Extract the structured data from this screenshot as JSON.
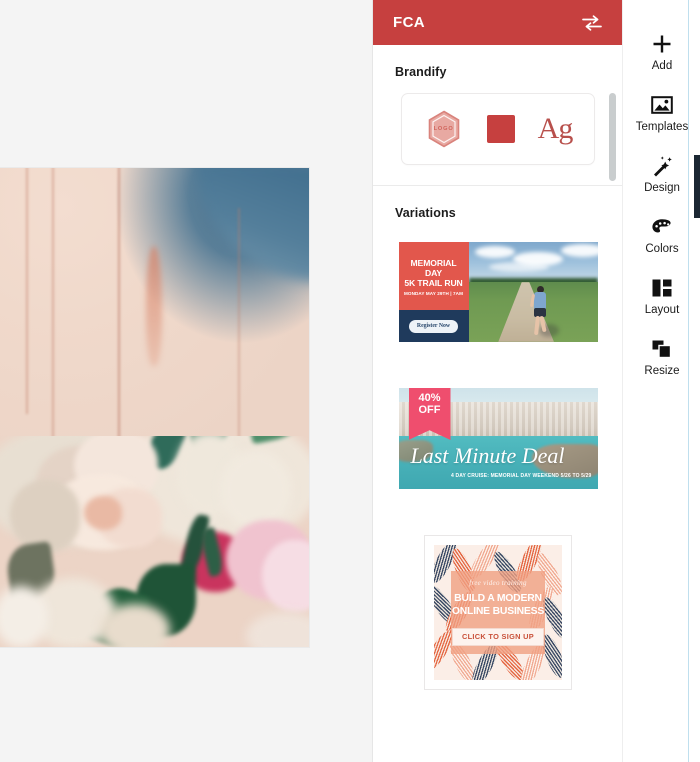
{
  "panel": {
    "header": {
      "title": "FCA",
      "swap_icon": "swap-horizontal-icon"
    },
    "brandify": {
      "section_title": "Brandify",
      "logo_badge_label": "LOGO",
      "color_swatch_hex": "#c6403f",
      "type_sample": "Ag"
    },
    "variations": {
      "section_title": "Variations",
      "items": [
        {
          "name": "memorial-day-5k-trail-run",
          "headline": "MEMORIAL DAY\n5K TRAIL RUN",
          "headline_line1": "MEMORIAL DAY",
          "headline_line2": "5K TRAIL RUN",
          "date_line": "MONDAY MAY 29TH | 7AM",
          "cta": "Register Now",
          "accent_hex": "#e2574c",
          "panel_hex": "#1f3a5c"
        },
        {
          "name": "last-minute-cruise-deal",
          "badge_line1": "40%",
          "badge_line2": "OFF",
          "headline": "Last Minute Deal",
          "subtitle": "4 DAY CRUISE: MEMORIAL DAY WEEKEND 5/26 TO 5/29",
          "accent_hex": "#ef4e6e",
          "sea_hex": "#4bb5bb"
        },
        {
          "name": "build-modern-online-business",
          "eyebrow": "free video training",
          "headline_line1": "BUILD A MODERN",
          "headline_line2": "ONLINE BUSINESS",
          "cta": "CLICK TO SIGN UP",
          "accent_hex": "#f0a082"
        }
      ]
    }
  },
  "rail": {
    "items": [
      {
        "label": "Add",
        "icon": "plus-icon"
      },
      {
        "label": "Templates",
        "icon": "image-icon"
      },
      {
        "label": "Design",
        "icon": "magic-wand-icon"
      },
      {
        "label": "Colors",
        "icon": "palette-icon"
      },
      {
        "label": "Layout",
        "icon": "layout-columns-icon"
      },
      {
        "label": "Resize",
        "icon": "resize-frames-icon"
      }
    ]
  },
  "canvas": {
    "name": "design-canvas",
    "artwork_description": "blurred photo of pale blush roses bouquet with greenery against cream wall and blue sky"
  }
}
